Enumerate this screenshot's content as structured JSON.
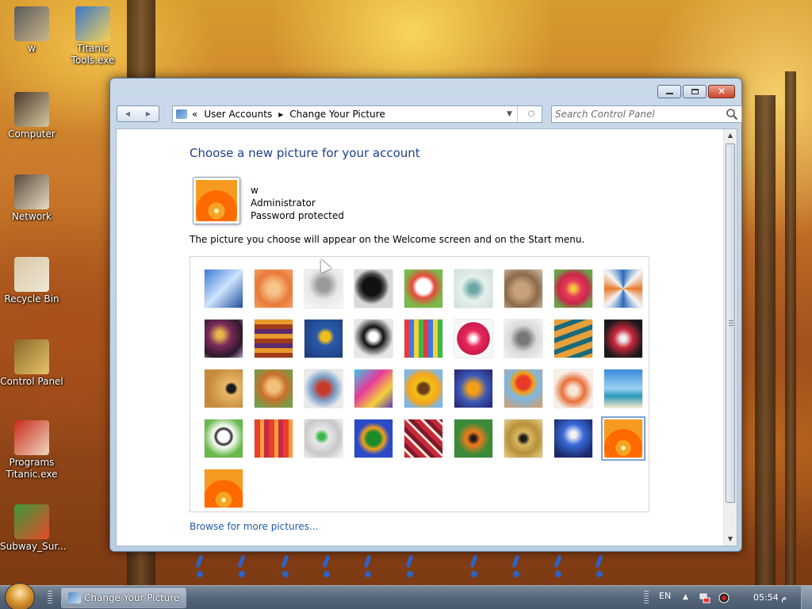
{
  "desktop": {
    "icons": [
      {
        "label": "w",
        "color_a": "#5a5a5a",
        "color_b": "#c9b58a"
      },
      {
        "label": "Titanic\nTools.exe",
        "color_a": "#3a78c9",
        "color_b": "#f2d15a"
      },
      {
        "label": "Computer",
        "color_a": "#4a3a2a",
        "color_b": "#d8c7a2"
      },
      {
        "label": "Network",
        "color_a": "#5a4a3a",
        "color_b": "#e6dcc3"
      },
      {
        "label": "Recycle Bin",
        "color_a": "#d8c7a8",
        "color_b": "#efe6d4"
      },
      {
        "label": "Control Panel",
        "color_a": "#8a6a2a",
        "color_b": "#e8c36a"
      },
      {
        "label": "Programs\nTitanic.exe",
        "color_a": "#c82a1a",
        "color_b": "#f0d8c0"
      },
      {
        "label": "Subway_Sur...",
        "color_a": "#3a9a3a",
        "color_b": "#e84a2a"
      }
    ]
  },
  "window": {
    "breadcrumb": [
      "«",
      "User Accounts",
      "▸",
      "Change Your Picture"
    ],
    "search_placeholder": "Search Control Panel",
    "heading": "Choose a new picture for your account",
    "user": {
      "name": "w",
      "role": "Administrator",
      "status": "Password protected"
    },
    "description": "The picture you choose will appear on the Welcome screen and on the Start menu.",
    "browse_link": "Browse for more pictures...",
    "selected_index": 35,
    "pictures": [
      {
        "name": "roller-coaster",
        "bg": "linear-gradient(135deg,#3a7bd5,#cfe3ff 50%,#1c4f99)"
      },
      {
        "name": "starfish",
        "bg": "radial-gradient(circle,#f7c58a 20%,#e87a3a 60%,#f3a060)"
      },
      {
        "name": "robot-toy",
        "bg": "radial-gradient(circle at 50% 40%,#9a9a9a 20%,#e6e6e6 50%,#fafafa)"
      },
      {
        "name": "turntable",
        "bg": "radial-gradient(circle at 45% 45%,#111 30%,#555 45%,#d8d8d8 60%)"
      },
      {
        "name": "lucky-cat",
        "bg": "radial-gradient(circle at 50% 45%,#fff 25%,#e84a3a 40%,#7ab94a 70%)"
      },
      {
        "name": "gyroscope",
        "bg": "radial-gradient(circle,#6aa8a8 15%,#e6f0ec 45%,#cfdde0)"
      },
      {
        "name": "kitten",
        "bg": "radial-gradient(circle at 45% 55%,#c8a07a 25%,#8a6a4a 55%,#d6c2aa)"
      },
      {
        "name": "flower-pink",
        "bg": "radial-gradient(circle,#f2c83a 8%,#e83a5a 30%,#c8284a 55%,#6aa04a 80%)"
      },
      {
        "name": "pinwheel",
        "bg": "conic-gradient(#2a6ab9,#f5f5f5,#e87a2a,#f5f5f5,#2a6ab9,#f5f5f5,#e87a2a,#f5f5f5,#2a6ab9)"
      },
      {
        "name": "ball-purple",
        "bg": "radial-gradient(circle at 40% 40%,#e7b84a 10%,#7a2a5a 35%,#2a1a2a 70%,#b8a0c0)"
      },
      {
        "name": "fabric-stripes",
        "bg": "repeating-linear-gradient(0deg,#a03a1a 0 6px,#e89a2a 6px 12px,#5a2a6a 12px 18px)"
      },
      {
        "name": "leaf-on-wood",
        "bg": "radial-gradient(circle at 55% 45%,#f2c01a 15%,#2a5aa8 30%,#1a3a7a 100%)"
      },
      {
        "name": "dog-bw",
        "bg": "radial-gradient(circle at 50% 45%,#fff 15%,#111 35%,#e6e6e6 70%)"
      },
      {
        "name": "crayons",
        "bg": "repeating-linear-gradient(90deg,#e83a3a 0 6px,#3a7ae8 6px 12px,#f2d23a 12px 18px,#3ab84a 18px 24px)"
      },
      {
        "name": "red-star",
        "bg": "radial-gradient(circle,#fff 8%,#e8285a 30%,#c81a4a 60%,#f7f7f7 62%)"
      },
      {
        "name": "jacks",
        "bg": "radial-gradient(circle,#777 20%,#d9d9d9 50%,#f5f5f5)"
      },
      {
        "name": "stairs",
        "bg": "repeating-linear-gradient(160deg,#e8a03a 0 8px,#1a6a7a 8px 14px)"
      },
      {
        "name": "paper-crane",
        "bg": "radial-gradient(circle,#f0f0f0 10%,#c8283a 35%,#1a1a1a 75%)"
      },
      {
        "name": "guitar",
        "bg": "radial-gradient(circle at 70% 50%,#1a1a1a 12%,#e8b86a 20%,#c88a3a 70%)"
      },
      {
        "name": "pomeranian",
        "bg": "radial-gradient(circle at 50% 45%,#f3c07a 20%,#c8702a 45%,#7a9a4a 80%)"
      },
      {
        "name": "tin-robot",
        "bg": "radial-gradient(circle,#c83a2a 20%,#7aa0c8 45%,#eaeaea 75%)"
      },
      {
        "name": "colorful-cloth",
        "bg": "linear-gradient(135deg,#3ac8e8,#e83a9a 40%,#f2d23a 70%,#5a3ab8)"
      },
      {
        "name": "sunflower",
        "bg": "radial-gradient(circle,#6a3a1a 18%,#f2c01a 30%,#f7a61a 55%,#7ab8e8 80%)"
      },
      {
        "name": "fish",
        "bg": "radial-gradient(circle at 50% 50%,#f2a01a 20%,#3a5ab8 50%,#2a2a7a 90%)"
      },
      {
        "name": "hot-air-balloon",
        "bg": "radial-gradient(circle at 50% 35%,#e83a2a 20%,#f2a01a 32%,#7ab8e8 50%,#c8a07a 90%)"
      },
      {
        "name": "doll-orange",
        "bg": "radial-gradient(circle at 50% 55%,#f8e6d8 15%,#e8703a 40%,#f7efe8 70%)"
      },
      {
        "name": "sailboat",
        "bg": "linear-gradient(180deg,#3a8ad8 0%,#9ad2f2 50%,#2a9ab8 70%,#f2e6c8 100%)"
      },
      {
        "name": "soccer-ball",
        "bg": "radial-gradient(circle at 50% 45%,#fff 20%,#222 28%,#fff 36%,#6ab84a 70%)"
      },
      {
        "name": "fabric-red",
        "bg": "repeating-linear-gradient(90deg,#e8402a 0 7px,#f7a03a 7px 12px,#c8284a 12px 18px)"
      },
      {
        "name": "marbles",
        "bg": "radial-gradient(circle at 45% 45%,#3ab84a 10%,#e8e8e8 25%,#c8c8c8 60%,#fafafa)"
      },
      {
        "name": "green-window",
        "bg": "radial-gradient(circle,#1a8a2a 25%,#f2a01a 40%,#2a4ac8 60%)"
      },
      {
        "name": "pattern-fabric",
        "bg": "repeating-linear-gradient(45deg,#c8283a 0 6px,#f2e6d8 6px 9px,#7a1a2a 9px 14px)"
      },
      {
        "name": "butterfly",
        "bg": "radial-gradient(circle,#1a1a1a 8%,#f27a1a 25%,#3a8a3a 60%)"
      },
      {
        "name": "wicker",
        "bg": "radial-gradient(circle,#1a1a1a 10%,#d8b860 25%,#b8903a 55%,#e8d08a)"
      },
      {
        "name": "lighthouse",
        "bg": "radial-gradient(circle at 50% 40%,#f2f2f2 10%,#3a6ad8 35%,#1a2a6a 80%)"
      },
      {
        "name": "flower-orange-selected",
        "bg": "radial-gradient(circle at 50% 75%,#fff4b0 0 6%,#f7a424 7% 22%,#ff6a00 23% 55%,#f79b20 56% 100%)"
      },
      {
        "name": "flower-orange",
        "bg": "radial-gradient(circle at 50% 80%,#fff4b0 0 6%,#f7a424 7% 22%,#ff6a00 23% 55%,#f79b20 56% 100%)"
      }
    ]
  },
  "taskbar": {
    "task_label": "Change Your Picture",
    "language": "EN",
    "clock": "05:54 م"
  }
}
